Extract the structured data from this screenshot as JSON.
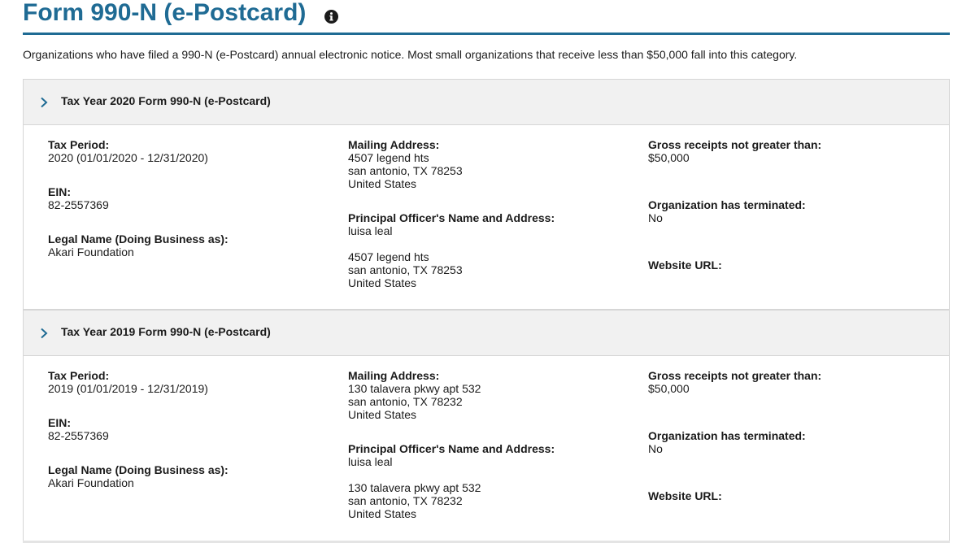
{
  "header": {
    "title": "Form 990-N (e-Postcard)",
    "info_icon": "info-circle-icon",
    "accent_color": "#1f6b94"
  },
  "intro": "Organizations who have filed a 990-N (e-Postcard) annual electronic notice. Most small organizations that receive less than $50,000 fall into this category.",
  "sections": [
    {
      "title": "Tax Year 2020 Form 990-N (e-Postcard)",
      "tax_period_label": "Tax Period:",
      "tax_period": "2020 (01/01/2020 - 12/31/2020)",
      "ein_label": "EIN:",
      "ein": "82-2557369",
      "legal_name_label": "Legal Name (Doing Business as):",
      "legal_name": "Akari Foundation",
      "mailing_label": "Mailing Address:",
      "mailing": [
        "4507 legend hts",
        "san antonio, TX 78253",
        "United States"
      ],
      "officer_label": "Principal Officer's Name and Address:",
      "officer_name": "luisa leal",
      "officer_address": [
        "4507 legend hts",
        "san antonio, TX 78253",
        "United States"
      ],
      "gross_label": "Gross receipts not greater than:",
      "gross": "$50,000",
      "terminated_label": "Organization has terminated:",
      "terminated": "No",
      "website_label": "Website URL:"
    },
    {
      "title": "Tax Year 2019 Form 990-N (e-Postcard)",
      "tax_period_label": "Tax Period:",
      "tax_period": "2019 (01/01/2019 - 12/31/2019)",
      "ein_label": "EIN:",
      "ein": "82-2557369",
      "legal_name_label": "Legal Name (Doing Business as):",
      "legal_name": "Akari Foundation",
      "mailing_label": "Mailing Address:",
      "mailing": [
        "130 talavera pkwy apt 532",
        "san antonio, TX 78232",
        "United States"
      ],
      "officer_label": "Principal Officer's Name and Address:",
      "officer_name": "luisa leal",
      "officer_address": [
        "130 talavera pkwy apt 532",
        "san antonio, TX 78232",
        "United States"
      ],
      "gross_label": "Gross receipts not greater than:",
      "gross": "$50,000",
      "terminated_label": "Organization has terminated:",
      "terminated": "No",
      "website_label": "Website URL:"
    }
  ]
}
